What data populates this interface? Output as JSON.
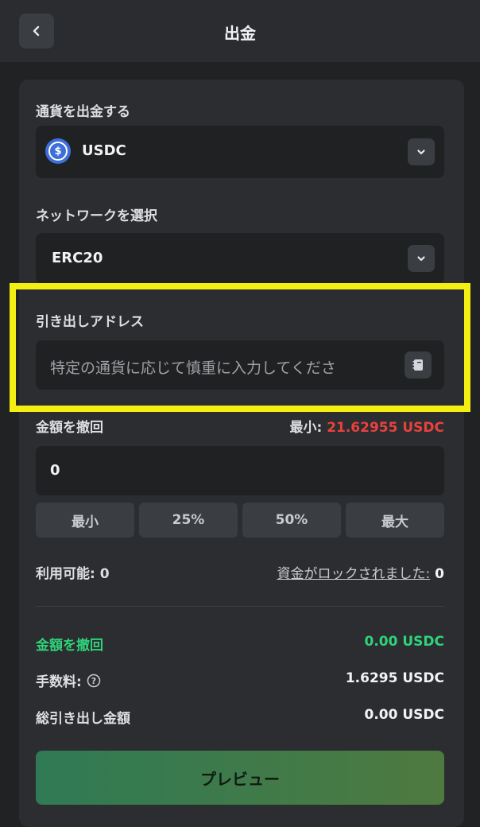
{
  "header": {
    "title": "出金"
  },
  "currency": {
    "label": "通貨を出金する",
    "selected": "USDC",
    "coin_symbol": "$"
  },
  "network": {
    "label": "ネットワークを選択",
    "selected": "ERC20"
  },
  "address": {
    "label": "引き出しアドレス",
    "placeholder": "特定の通貨に応じて慎重に入力してくださ"
  },
  "amount": {
    "label": "金額を撤回",
    "min_label": "最小:",
    "min_value": "21.62955 USDC",
    "value": "0",
    "quick_buttons": [
      "最小",
      "25%",
      "50%",
      "最大"
    ]
  },
  "balances": {
    "available_label": "利用可能:",
    "available_value": "0",
    "locked_label": "資金がロックされました:",
    "locked_value": "0"
  },
  "summary": {
    "withdraw_label": "金額を撤回",
    "withdraw_value": "0.00 USDC",
    "fee_label": "手数料:",
    "fee_value": "1.6295 USDC",
    "total_label": "総引き出し金額",
    "total_value": "0.00 USDC"
  },
  "actions": {
    "preview_label": "プレビュー"
  },
  "colors": {
    "accent_green": "#2fd37a",
    "min_red": "#e8413e",
    "highlight": "#f4ee13"
  }
}
